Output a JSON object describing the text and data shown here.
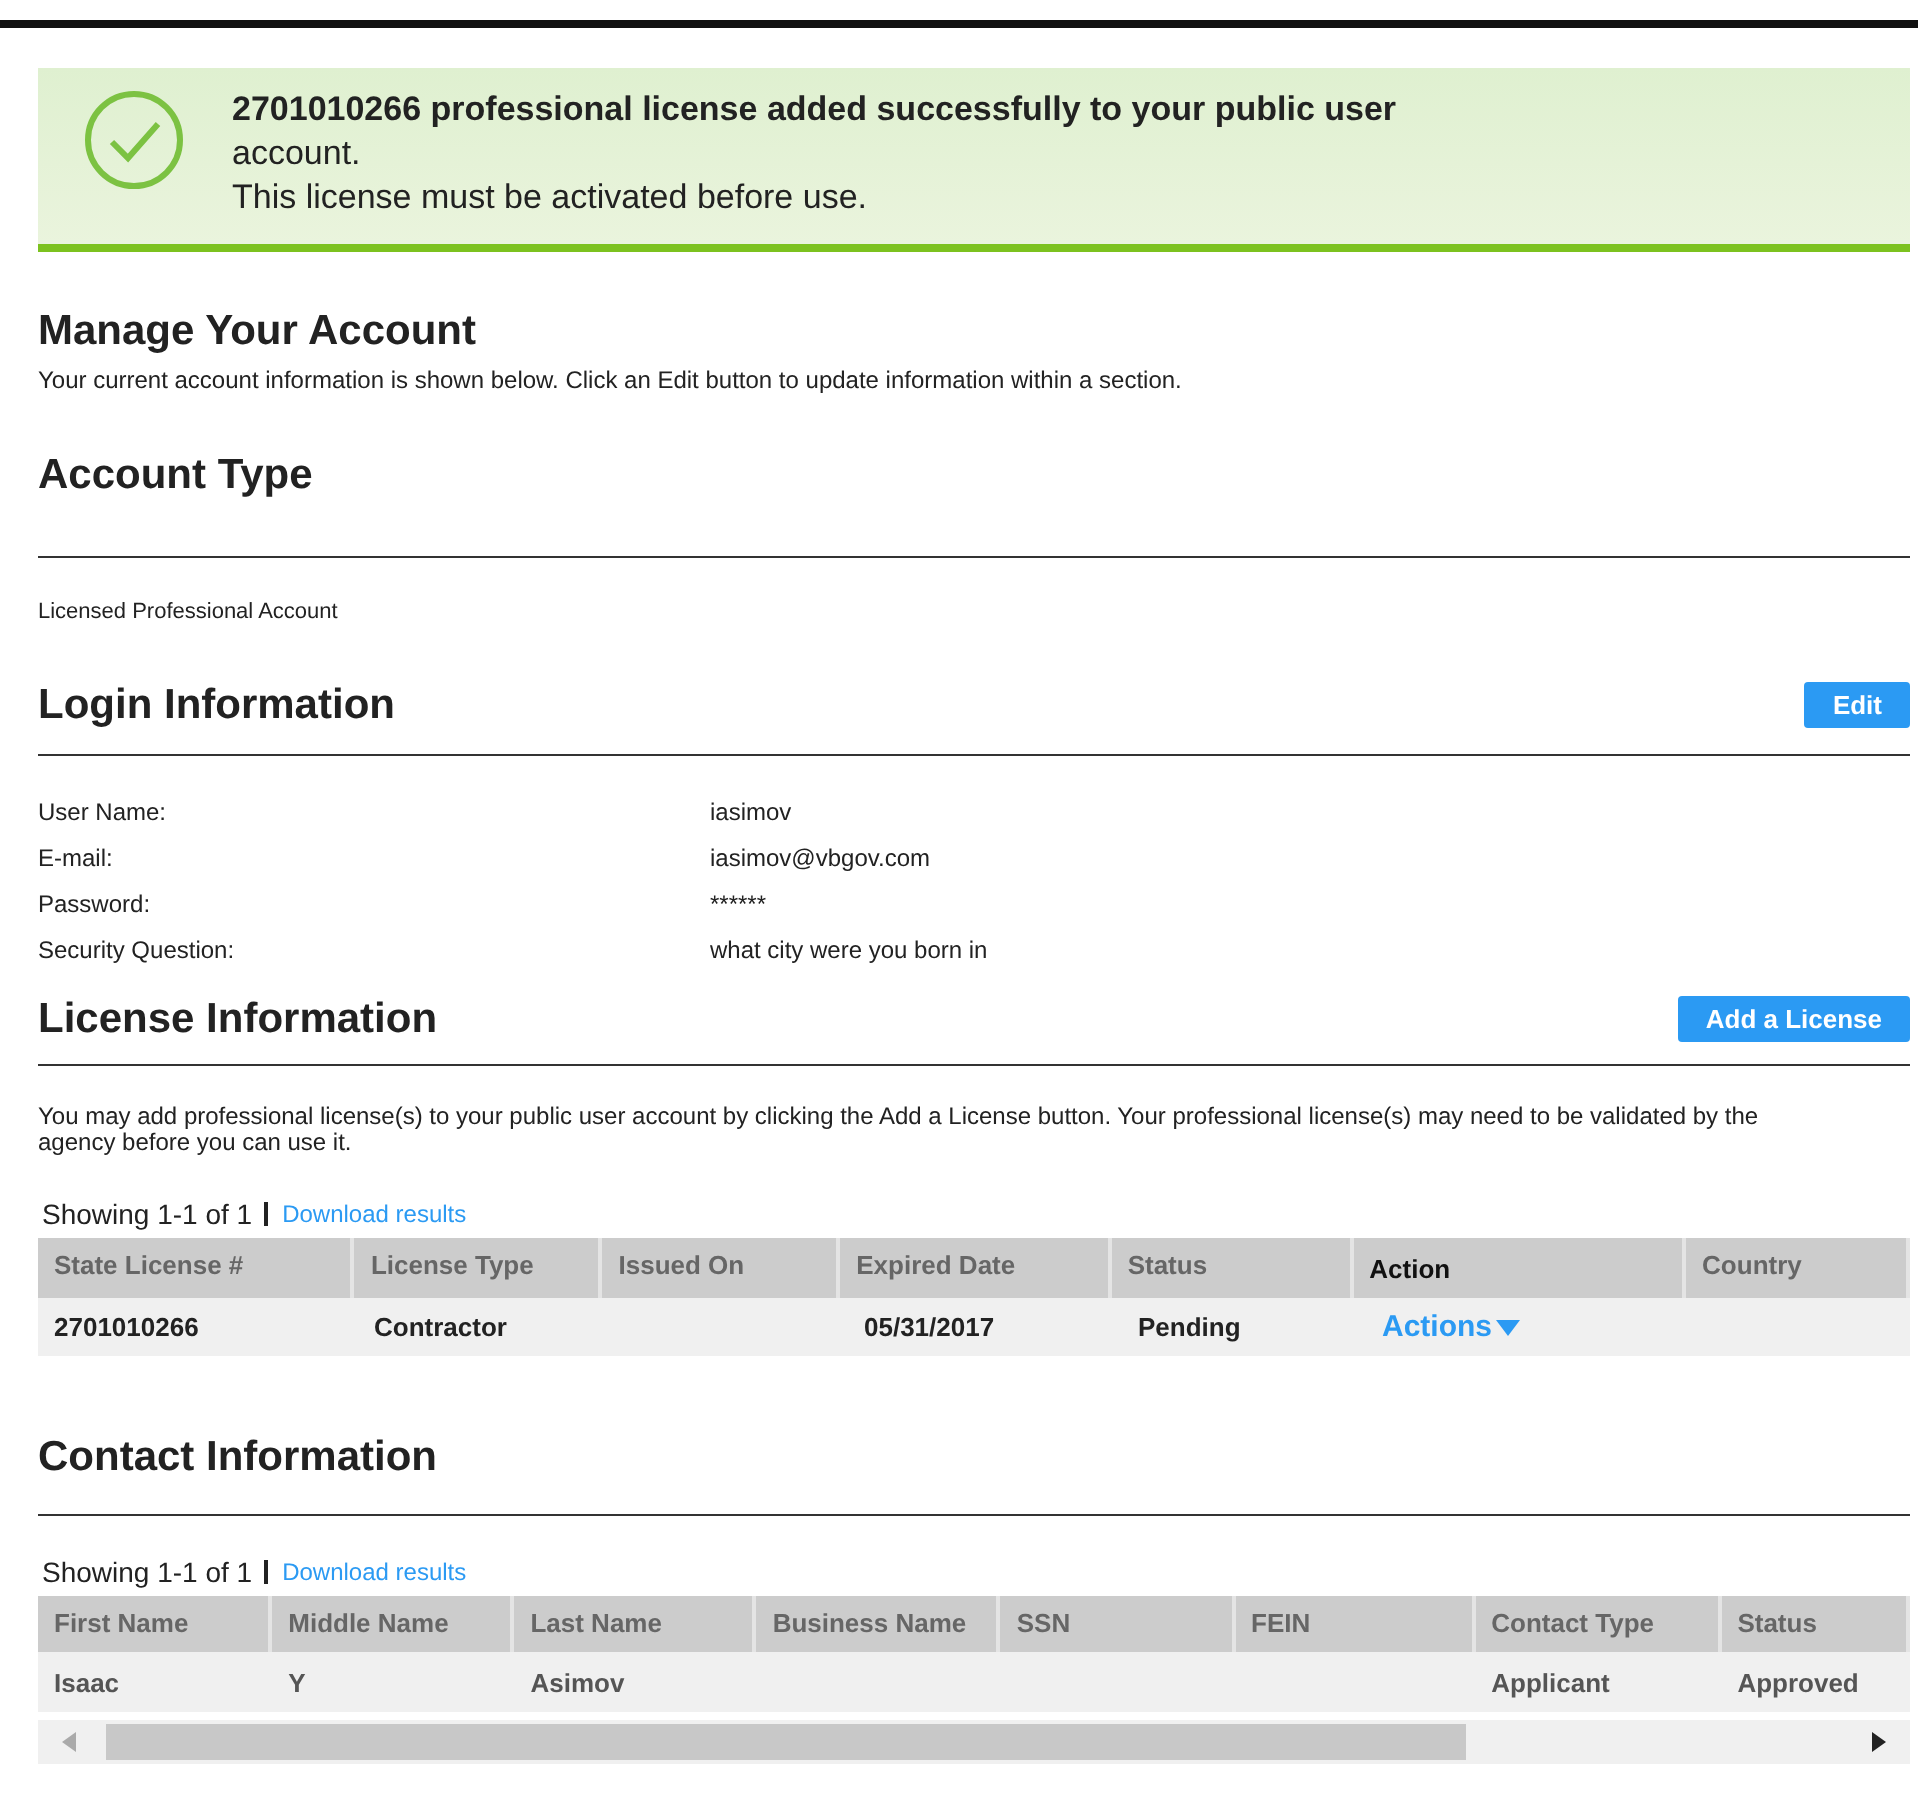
{
  "banner": {
    "headline": "2701010266 professional license added successfully to your public user",
    "lines": [
      "account.",
      "This license must be activated before use."
    ]
  },
  "manage": {
    "title": "Manage Your Account",
    "description": "Your current account information is shown below. Click an Edit button to update information within a section."
  },
  "account_type": {
    "title": "Account Type",
    "value": "Licensed Professional Account"
  },
  "login": {
    "title": "Login Information",
    "button": "Edit",
    "fields": [
      {
        "label": "User Name:",
        "value": "iasimov"
      },
      {
        "label": "E-mail:",
        "value": "iasimov@vbgov.com"
      },
      {
        "label": "Password:",
        "value": "******"
      },
      {
        "label": "Security Question:",
        "value": "what city were you born in"
      }
    ]
  },
  "license": {
    "title": "License Information",
    "button": "Add a License",
    "description": "You may add professional license(s) to your public user account by clicking the Add a License button. Your professional license(s) may need to be validated by the agency before you can use it.",
    "showing": "Showing 1-1 of 1",
    "download": "Download results",
    "columns": [
      {
        "label": "State License #",
        "active": false
      },
      {
        "label": "License Type",
        "active": false
      },
      {
        "label": "Issued On",
        "active": false
      },
      {
        "label": "Expired Date",
        "active": false
      },
      {
        "label": "Status",
        "active": false
      },
      {
        "label": "Action",
        "active": true
      },
      {
        "label": "Country",
        "active": false
      }
    ],
    "rows": [
      {
        "cells": [
          "2701010266",
          "Contractor",
          "",
          "05/31/2017",
          "Pending"
        ],
        "action": "Actions"
      }
    ]
  },
  "contact": {
    "title": "Contact Information",
    "showing": "Showing 1-1 of 1",
    "download": "Download results",
    "columns": [
      "First Name",
      "Middle Name",
      "Last Name",
      "Business Name",
      "SSN",
      "FEIN",
      "Contact Type",
      "Status"
    ],
    "rows": [
      {
        "cells": [
          "Isaac",
          "Y",
          "Asimov",
          "",
          "",
          "",
          "Applicant",
          "Approved"
        ]
      }
    ]
  }
}
